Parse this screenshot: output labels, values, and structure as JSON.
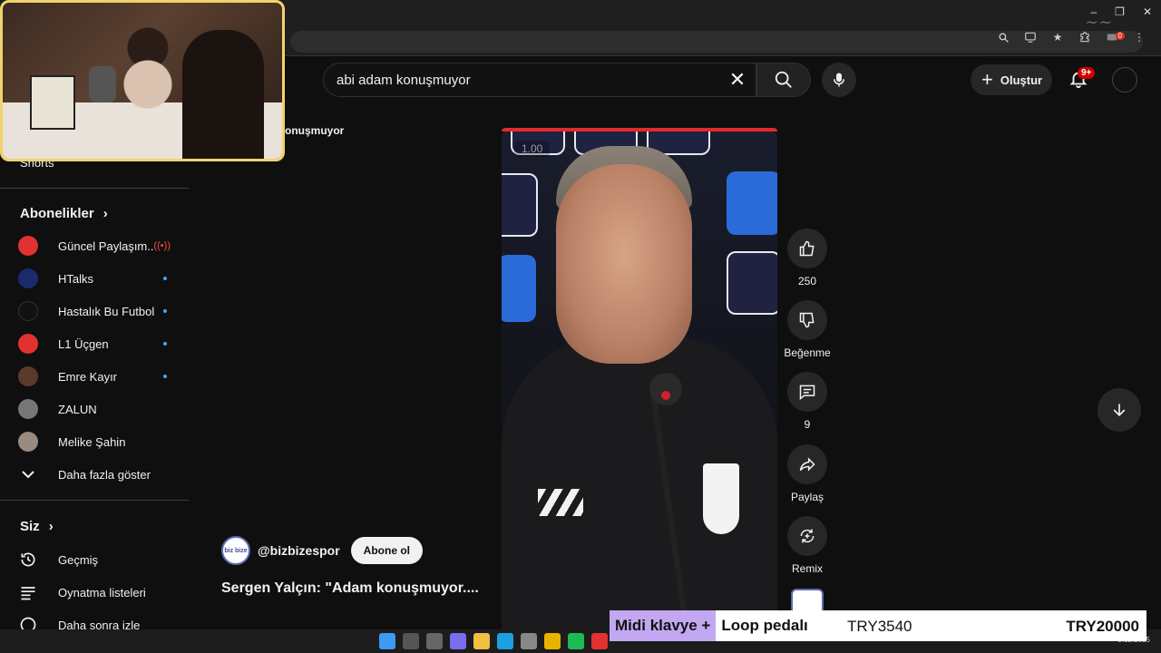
{
  "header": {
    "search_query": "abi adam konuşmuyor",
    "create_label": "Oluştur",
    "notif_count": "9+"
  },
  "browser": {
    "ext_badge": "0",
    "window_controls": [
      "–",
      "❐",
      "✕"
    ]
  },
  "partial_title": "onuşmuyor",
  "sidebar": {
    "shorts_label": "Shorts",
    "subscriptions_title": "Abonelikler",
    "subscriptions": [
      {
        "label": "Güncel Paylaşım...",
        "color": "#e23131",
        "status": "live"
      },
      {
        "label": "HTalks",
        "color": "#1c2a6b",
        "status": "dot"
      },
      {
        "label": "Hastalık Bu Futbol",
        "color": "#111111",
        "status": "dot"
      },
      {
        "label": "L1 Üçgen",
        "color": "#e23131",
        "status": "dot"
      },
      {
        "label": "Emre Kayır",
        "color": "#5a3a2a",
        "status": "dot"
      },
      {
        "label": "ZALUN",
        "color": "#777777",
        "status": "none"
      },
      {
        "label": "Melike Şahin",
        "color": "#9a8a80",
        "status": "none"
      }
    ],
    "show_more": "Daha fazla göster",
    "you_title": "Siz",
    "you_items": [
      {
        "label": "Geçmiş",
        "icon": "history-icon"
      },
      {
        "label": "Oynatma listeleri",
        "icon": "playlist-icon"
      },
      {
        "label": "Daha sonra izle",
        "icon": "clock-icon"
      }
    ]
  },
  "video": {
    "speed_label": "1.00",
    "channel_handle": "@bizbizespor",
    "channel_avatar_text": "biz bize",
    "subscribe_label": "Abone ol",
    "title": "Sergen Yalçın: \"Adam konuşmuyor...."
  },
  "actions": {
    "like_count": "250",
    "dislike_label": "Beğenme",
    "comments_count": "9",
    "share_label": "Paylaş",
    "remix_label": "Remix"
  },
  "ticker": {
    "highlight": "Midi klavye +",
    "rest": "Loop pedalı",
    "price1": "TRY3540",
    "price2": "TRY20000"
  },
  "taskbar": {
    "date": "3.12.2025"
  },
  "colors": {
    "webcam_border": "#f2d36b",
    "live_red": "#ff4e45",
    "dot_blue": "#3ea6ff",
    "notif_red": "#cc0000",
    "ticker_purple": "#c2a8f0"
  }
}
